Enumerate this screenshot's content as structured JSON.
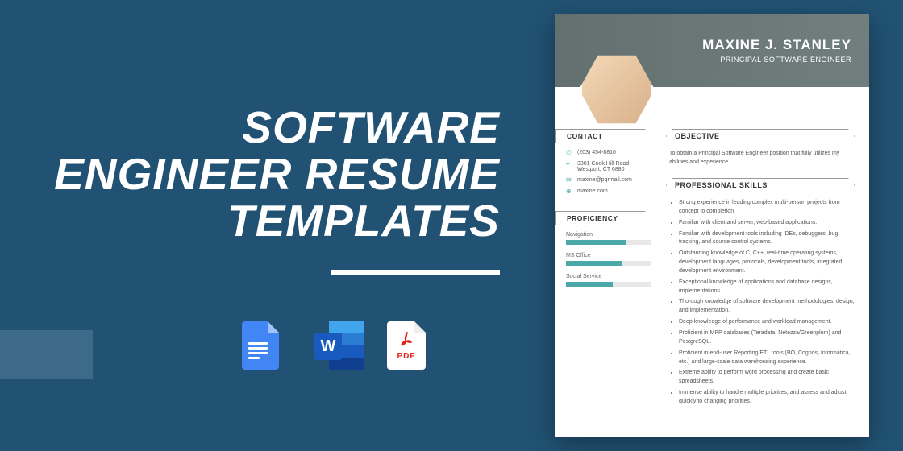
{
  "headline": {
    "line1": "SOFTWARE",
    "line2": "ENGINEER RESUME",
    "line3": "TEMPLATES"
  },
  "icons": {
    "word_letter": "W",
    "pdf_label": "PDF"
  },
  "resume": {
    "name": "MAXINE J. STANLEY",
    "title": "PRINCIPAL SOFTWARE ENGINEER",
    "sections": {
      "contact": "CONTACT",
      "proficiency": "PROFICIENCY",
      "objective": "OBJECTIVE",
      "skills": "PROFESSIONAL SKILLS"
    },
    "contact": {
      "phone": "(203) 454-8810",
      "address": "3301 Cook Hill Road Westport, CT 6880",
      "email": "maxine@pqrmail.com",
      "web": "maxine.com"
    },
    "proficiency": [
      {
        "label": "Navigation",
        "pct": 70
      },
      {
        "label": "MS Office",
        "pct": 65
      },
      {
        "label": "Social Service",
        "pct": 55
      }
    ],
    "objective": "To obtain a Principal Software Engineer position that fully utilizes my abilities and experience.",
    "skills": [
      "Strong experience in leading complex multi-person projects from concept to completion",
      "Familiar with client and server, web-based applications.",
      "Familiar with development tools including IDEs, debuggers, bug tracking, and source control systems.",
      "Outstanding knowledge of C, C++, real-time operating systems, development languages, protocols, development tools, integrated development environment.",
      "Exceptional knowledge of applications and database designs, implementations",
      "Thorough knowledge of software development methodologies, design, and implementation.",
      "Deep knowledge of performance and workload management.",
      "Proficient in MPP databases (Teradata, Netezza/Greenplum) and PostgreSQL.",
      "Proficient in end-user Reporting/ETL tools (BO, Cognos, Informatica, etc.) and large-scale data warehousing experience.",
      "Extreme ability to perform word processing and create basic spreadsheets.",
      "Immense ability to handle multiple priorities, and assess and adjust quickly to changing priorities."
    ]
  }
}
